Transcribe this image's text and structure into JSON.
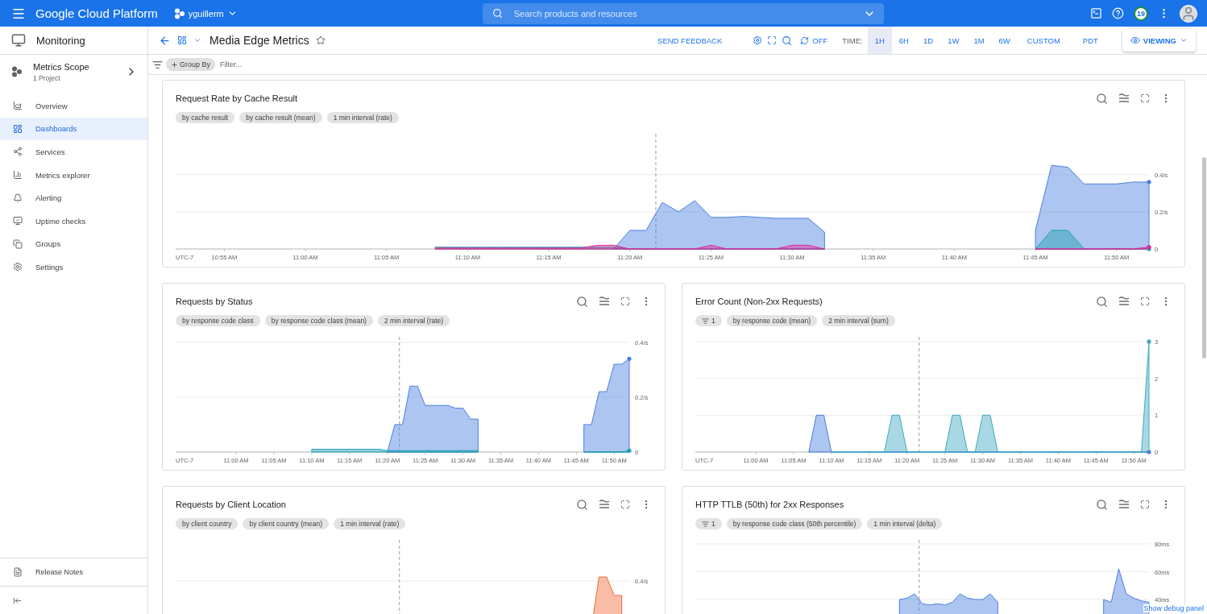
{
  "header": {
    "product": "Google Cloud Platform",
    "project": "yguillerm",
    "search": {
      "placeholder": "Search products and resources"
    },
    "notifications": "19"
  },
  "sidebar": {
    "title": "Monitoring",
    "scope": {
      "title": "Metrics Scope",
      "subtitle": "1 Project"
    },
    "items": [
      {
        "label": "Overview",
        "selected": false
      },
      {
        "label": "Dashboards",
        "selected": true
      },
      {
        "label": "Services",
        "selected": false
      },
      {
        "label": "Metrics explorer",
        "selected": false
      },
      {
        "label": "Alerting",
        "selected": false
      },
      {
        "label": "Uptime checks",
        "selected": false
      },
      {
        "label": "Groups",
        "selected": false
      },
      {
        "label": "Settings",
        "selected": false
      }
    ],
    "footer": "Release Notes"
  },
  "toolbar": {
    "title": "Media Edge Metrics",
    "feedback": "SEND FEEDBACK",
    "refresh": "OFF",
    "time_label": "TIME:",
    "ranges": [
      {
        "label": "1H",
        "selected": true
      },
      {
        "label": "6H",
        "selected": false
      },
      {
        "label": "1D",
        "selected": false
      },
      {
        "label": "1W",
        "selected": false
      },
      {
        "label": "1M",
        "selected": false
      },
      {
        "label": "6W",
        "selected": false
      },
      {
        "label": "CUSTOM",
        "selected": false
      }
    ],
    "timezone": "PDT",
    "mode": "VIEWING"
  },
  "filter_bar": {
    "group_by": "Group By",
    "placeholder": "Filter..."
  },
  "rows": [
    [
      {
        "title": "Request Rate by Cache Result",
        "chips": [
          {
            "kind": "text",
            "label": "by cache result"
          },
          {
            "kind": "text",
            "label": "by cache result (mean)"
          },
          {
            "kind": "text",
            "label": "1 min interval (rate)"
          }
        ],
        "chart_data": {
          "type": "area",
          "xlabel": "UTC-7",
          "categories": [
            null,
            null,
            null,
            "10:55 AM",
            null,
            null,
            null,
            null,
            "11:00 AM",
            null,
            null,
            null,
            null,
            "11:05 AM",
            null,
            null,
            null,
            null,
            "11:10 AM",
            null,
            null,
            null,
            null,
            "11:15 AM",
            null,
            null,
            null,
            null,
            "11:20 AM",
            null,
            null,
            null,
            null,
            "11:25 AM",
            null,
            null,
            null,
            null,
            "11:30 AM",
            null,
            null,
            null,
            null,
            "11:35 AM",
            null,
            null,
            null,
            null,
            "11:40 AM",
            null,
            null,
            null,
            null,
            "11:45 AM",
            null,
            null,
            null,
            null,
            "11:50 AM",
            null,
            null
          ],
          "ylim": [
            0,
            0.62
          ],
          "yticks": [
            {
              "value": 0,
              "label": "0"
            },
            {
              "value": 0.2,
              "label": "0.2/s"
            },
            {
              "value": 0.4,
              "label": "0.4/s"
            }
          ],
          "grid": true,
          "series": [
            {
              "color": "#4a7fe0",
              "values": [
                null,
                null,
                null,
                null,
                null,
                null,
                null,
                null,
                null,
                null,
                null,
                null,
                null,
                null,
                null,
                null,
                null,
                null,
                null,
                null,
                null,
                null,
                null,
                null,
                null,
                null,
                null,
                0,
                0.1,
                0.1,
                0.25,
                0.2,
                0.26,
                0.17,
                0.17,
                0.175,
                0.17,
                0.165,
                0.165,
                0.165,
                0.09,
                null,
                null,
                null,
                null,
                null,
                null,
                null,
                null,
                null,
                null,
                null,
                null,
                0.1,
                0.45,
                0.44,
                0.35,
                0.35,
                0.35,
                0.36,
                0.36
              ]
            },
            {
              "color": "#1fa0b0",
              "values": [
                null,
                null,
                null,
                null,
                null,
                null,
                null,
                null,
                null,
                null,
                null,
                null,
                null,
                null,
                null,
                null,
                0.01,
                0.01,
                0.01,
                0.01,
                0.01,
                0.01,
                0.01,
                0.01,
                0.01,
                0.01,
                0.01,
                0.01,
                0,
                0,
                0,
                0,
                0,
                0,
                0,
                0,
                0,
                0,
                0,
                0,
                0,
                null,
                null,
                null,
                null,
                null,
                null,
                null,
                null,
                null,
                null,
                null,
                null,
                0,
                0.1,
                0.1,
                0,
                0,
                0,
                0,
                0
              ]
            },
            {
              "color": "#e52592",
              "values": [
                null,
                null,
                null,
                null,
                null,
                null,
                null,
                null,
                null,
                null,
                null,
                null,
                null,
                null,
                null,
                null,
                0.005,
                0.005,
                0.005,
                0.005,
                0.005,
                0.005,
                0.005,
                0.005,
                0.005,
                0.005,
                0.02,
                0.02,
                0,
                0,
                0,
                0,
                0,
                0.02,
                0,
                0,
                0,
                0,
                0.02,
                0.02,
                0,
                null,
                null,
                null,
                null,
                null,
                null,
                null,
                null,
                null,
                null,
                null,
                null,
                0,
                0,
                0,
                0,
                0,
                0,
                0,
                0.01
              ]
            }
          ]
        }
      }
    ],
    [
      {
        "title": "Requests by Status",
        "chips": [
          {
            "kind": "text",
            "label": "by response code class"
          },
          {
            "kind": "text",
            "label": "by response code class (mean)"
          },
          {
            "kind": "text",
            "label": "2 min interval (rate)"
          }
        ],
        "chart_data": {
          "type": "area",
          "xlabel": "UTC-7",
          "categories": [
            null,
            null,
            null,
            null,
            null,
            null,
            null,
            null,
            "11:00 AM",
            null,
            null,
            null,
            null,
            "11:05 AM",
            null,
            null,
            null,
            null,
            "11:10 AM",
            null,
            null,
            null,
            null,
            "11:15 AM",
            null,
            null,
            null,
            null,
            "11:20 AM",
            null,
            null,
            null,
            null,
            "11:25 AM",
            null,
            null,
            null,
            null,
            "11:30 AM",
            null,
            null,
            null,
            null,
            "11:35 AM",
            null,
            null,
            null,
            null,
            "11:40 AM",
            null,
            null,
            null,
            null,
            "11:45 AM",
            null,
            null,
            null,
            null,
            "11:50 AM",
            null,
            null
          ],
          "ylim": [
            0,
            0.42
          ],
          "yticks": [
            {
              "value": 0,
              "label": "0"
            },
            {
              "value": 0.2,
              "label": "0.2/s"
            },
            {
              "value": 0.4,
              "label": "0.4/s"
            }
          ],
          "grid": true,
          "series": [
            {
              "color": "#4a7fe0",
              "values": [
                null,
                null,
                null,
                null,
                null,
                null,
                null,
                null,
                null,
                null,
                null,
                null,
                null,
                null,
                null,
                null,
                null,
                null,
                null,
                null,
                null,
                null,
                null,
                null,
                null,
                null,
                null,
                null,
                0,
                0.1,
                0.1,
                0.24,
                0.24,
                0.17,
                0.17,
                0.17,
                0.17,
                0.16,
                0.16,
                0.12,
                0.12,
                null,
                null,
                null,
                null,
                null,
                null,
                null,
                null,
                null,
                null,
                null,
                null,
                null,
                0.1,
                0.1,
                0.22,
                0.22,
                0.32,
                0.32,
                0.34
              ]
            },
            {
              "color": "#1fa0b0",
              "values": [
                null,
                null,
                null,
                null,
                null,
                null,
                null,
                null,
                null,
                null,
                null,
                null,
                null,
                null,
                null,
                null,
                null,
                null,
                0.01,
                0.01,
                0.01,
                0.01,
                0.01,
                0.01,
                0.01,
                0.01,
                0.01,
                0.01,
                0.005,
                0.005,
                0.005,
                0.005,
                0.005,
                0.005,
                0.005,
                0.005,
                0.005,
                0.005,
                0.005,
                0.005,
                0.005,
                null,
                null,
                null,
                null,
                null,
                null,
                null,
                null,
                null,
                null,
                null,
                null,
                null,
                0,
                0,
                0,
                0,
                0,
                0,
                0.005
              ]
            }
          ]
        }
      },
      {
        "title": "Error Count (Non-2xx Requests)",
        "chips": [
          {
            "kind": "filter",
            "label": "1"
          },
          {
            "kind": "text",
            "label": "by response code (mean)"
          },
          {
            "kind": "text",
            "label": "2 min interval (sum)"
          }
        ],
        "chart_data": {
          "type": "area",
          "xlabel": "UTC-7",
          "categories": [
            null,
            null,
            null,
            null,
            null,
            null,
            null,
            null,
            "11:00 AM",
            null,
            null,
            null,
            null,
            "11:05 AM",
            null,
            null,
            null,
            null,
            "11:10 AM",
            null,
            null,
            null,
            null,
            "11:15 AM",
            null,
            null,
            null,
            null,
            "11:20 AM",
            null,
            null,
            null,
            null,
            "11:25 AM",
            null,
            null,
            null,
            null,
            "11:30 AM",
            null,
            null,
            null,
            null,
            "11:35 AM",
            null,
            null,
            null,
            null,
            "11:40 AM",
            null,
            null,
            null,
            null,
            "11:45 AM",
            null,
            null,
            null,
            null,
            "11:50 AM",
            null,
            null
          ],
          "ylim": [
            0,
            3.13
          ],
          "yticks": [
            0,
            1,
            2,
            3
          ],
          "grid": true,
          "series": [
            {
              "color": "#4a7fe0",
              "values": [
                null,
                null,
                null,
                null,
                null,
                null,
                null,
                null,
                null,
                null,
                null,
                null,
                null,
                null,
                null,
                0,
                1,
                1,
                0,
                0,
                0,
                0,
                0,
                0,
                0,
                0,
                0,
                0,
                0,
                0,
                0,
                0,
                0,
                0,
                0,
                0,
                0,
                0,
                0,
                0,
                0,
                0,
                0,
                0,
                0,
                0,
                0,
                0,
                0,
                0,
                0,
                0,
                0,
                0,
                0,
                0,
                0,
                0,
                0,
                0,
                0
              ]
            },
            {
              "color": "#3fa9c0",
              "values": [
                null,
                null,
                null,
                null,
                null,
                null,
                null,
                null,
                null,
                null,
                null,
                null,
                null,
                null,
                null,
                null,
                null,
                null,
                0,
                0,
                0,
                0,
                0,
                0,
                0,
                0,
                1,
                1,
                0,
                0,
                0,
                0,
                0,
                0,
                1,
                1,
                0,
                0,
                1,
                1,
                0,
                0,
                0,
                0,
                0,
                0,
                0,
                0,
                0,
                0,
                0,
                0,
                0,
                0,
                0,
                0,
                0,
                0,
                0,
                0,
                3
              ]
            }
          ]
        }
      }
    ],
    [
      {
        "title": "Requests by Client Location",
        "chips": [
          {
            "kind": "text",
            "label": "by client country"
          },
          {
            "kind": "text",
            "label": "by client country (mean)"
          },
          {
            "kind": "text",
            "label": "1 min interval (rate)"
          }
        ],
        "kind": "spike",
        "scale_labels": [
          "0.4/s"
        ]
      },
      {
        "title": "HTTP TTLB (50th) for 2xx Responses",
        "chips": [
          {
            "kind": "filter",
            "label": "1"
          },
          {
            "kind": "text",
            "label": "by response code class (50th percentile)"
          },
          {
            "kind": "text",
            "label": "1 min interval (delta)"
          }
        ],
        "kind": "latency",
        "scale_labels": [
          "80ms",
          "60ms",
          "40ms"
        ]
      }
    ]
  ],
  "debug_link": "Show debug panel"
}
